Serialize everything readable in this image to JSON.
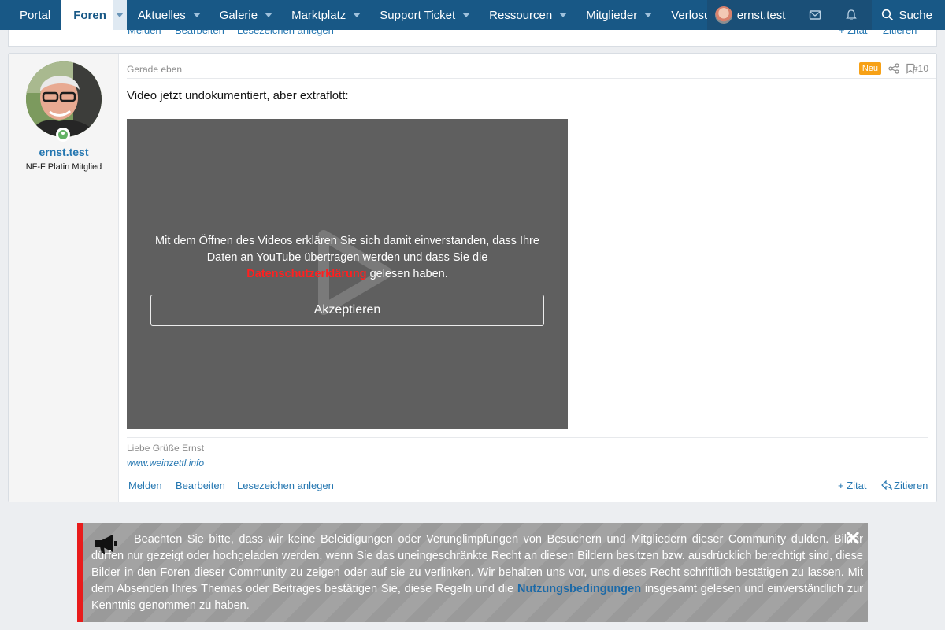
{
  "nav": {
    "items": [
      {
        "label": "Portal",
        "has_caret": false
      },
      {
        "label": "Foren",
        "has_caret": true,
        "active": true
      },
      {
        "label": "Aktuelles",
        "has_caret": true
      },
      {
        "label": "Galerie",
        "has_caret": true
      },
      {
        "label": "Marktplatz",
        "has_caret": true
      },
      {
        "label": "Support Ticket",
        "has_caret": true
      },
      {
        "label": "Ressourcen",
        "has_caret": true
      },
      {
        "label": "Mitglieder",
        "has_caret": true
      },
      {
        "label": "Verlosungen",
        "has_caret": false
      }
    ],
    "scroll_arrow": "›",
    "user": "ernst.test",
    "search": "Suche",
    "colors": {
      "bar": "#185886",
      "active_text": "#185886"
    }
  },
  "prev_post": {
    "actions": [
      "Melden",
      "Bearbeiten",
      "Lesezeichen anlegen"
    ],
    "right_actions": [
      "+ Zitat",
      "Zitieren"
    ]
  },
  "post": {
    "username": "ernst.test",
    "user_title": "NF-F Platin Mitglied",
    "time": "Gerade eben",
    "badge": "Neu",
    "number": "#10",
    "text": "Video jetzt undokumentiert, aber extraflott:",
    "video": {
      "message_part1": "Mit dem Öffnen des Videos erklären Sie sich damit einverstanden, dass Ihre Daten an YouTube übertragen werden und dass Sie die ",
      "privacy_link": "Datenschutzerklärung",
      "message_part2": " gelesen haben.",
      "accept_button": "Akzeptieren"
    },
    "signature": {
      "greeting": "Liebe Grüße Ernst",
      "website": "www.weinzettl.info"
    },
    "actions": {
      "report": "Melden",
      "edit": "Bearbeiten",
      "bookmark": "Lesezeichen anlegen",
      "quote_add": "+ Zitat",
      "quote": "Zitieren"
    },
    "colors": {
      "badge": "#f7a116",
      "link": "#2577b1",
      "privacy_link": "#ff2020"
    }
  },
  "notice": {
    "text_part1": "Beachten Sie bitte, dass wir keine Beleidigungen oder Verunglimpfungen von Besuchern und Mitgliedern dieser Community dulden. Bilder dürfen nur gezeigt oder hochgeladen werden, wenn Sie das uneingeschränkte Recht an diesen Bildern besitzen bzw. ausdrücklich berechtigt sind, diese Bilder in den Foren dieser Community zu zeigen oder auf sie zu verlinken. Wir behalten uns vor, uns dieses Recht schriftlich bestätigen zu lassen. Mit dem Absenden Ihres Themas oder Beitrages bestätigen Sie, diese Regeln und die ",
    "link": "Nutzungsbedingungen",
    "text_part2": " insgesamt gelesen und einverständlich zur Kenntnis genommen zu haben.",
    "colors": {
      "accent": "#e81b1b",
      "link": "#1c6aa8"
    }
  }
}
